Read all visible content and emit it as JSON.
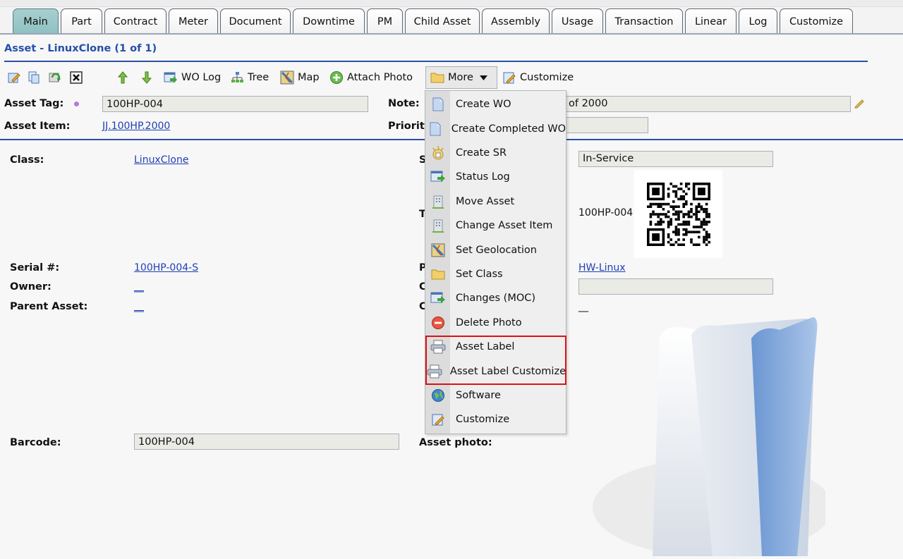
{
  "tabs": [
    {
      "label": "Main",
      "active": true
    },
    {
      "label": "Part"
    },
    {
      "label": "Contract"
    },
    {
      "label": "Meter"
    },
    {
      "label": "Document"
    },
    {
      "label": "Downtime"
    },
    {
      "label": "PM"
    },
    {
      "label": "Child Asset"
    },
    {
      "label": "Assembly"
    },
    {
      "label": "Usage"
    },
    {
      "label": "Transaction"
    },
    {
      "label": "Linear"
    },
    {
      "label": "Log"
    },
    {
      "label": "Customize"
    }
  ],
  "page": {
    "title": "Asset - LinuxClone (1 of 1)"
  },
  "toolbar": {
    "wo_log": "WO Log",
    "tree": "Tree",
    "map": "Map",
    "attach_photo": "Attach Photo",
    "more": "More",
    "customize": "Customize"
  },
  "form": {
    "asset_tag_label": "Asset Tag:",
    "asset_tag_value": "100HP-004",
    "note_label": "Note:",
    "note_value_visible": "of 2000",
    "asset_item_label": "Asset Item:",
    "asset_item_value": "JJ.100HP.2000",
    "priority_label": "Priority",
    "class_label": "Class:",
    "class_value": "LinuxClone",
    "status_value": "In-Service",
    "tag_value": "100HP-004",
    "serial_label": "Serial #:",
    "serial_value": "100HP-004-S",
    "owner_label": "Owner:",
    "owner_value": "__",
    "parent_label": "Parent Asset:",
    "parent_value": "__",
    "platform_value": "HW-Linux",
    "blank_value": "__",
    "barcode_label": "Barcode:",
    "barcode_value": "100HP-004",
    "photo_label": "Asset photo:",
    "hidden_label_s": "S",
    "hidden_label_t": "T",
    "hidden_label_p": "P",
    "hidden_label_c1": "C",
    "hidden_label_c2": "C"
  },
  "menu": {
    "items": [
      {
        "label": "Create WO",
        "icon": "document-icon"
      },
      {
        "label": "Create Completed WO",
        "icon": "document-icon"
      },
      {
        "label": "Create SR",
        "icon": "service-request-icon"
      },
      {
        "label": "Status Log",
        "icon": "log-icon"
      },
      {
        "label": "Move Asset",
        "icon": "building-icon"
      },
      {
        "label": "Change Asset Item",
        "icon": "building-icon"
      },
      {
        "label": "Set Geolocation",
        "icon": "map-icon"
      },
      {
        "label": "Set Class",
        "icon": "folder-icon"
      },
      {
        "label": "Changes (MOC)",
        "icon": "log-icon"
      },
      {
        "label": "Delete Photo",
        "icon": "delete-icon"
      },
      {
        "label": "Asset Label",
        "icon": "printer-icon"
      },
      {
        "label": "Asset Label Customize",
        "icon": "printer-icon"
      },
      {
        "label": "Software",
        "icon": "globe-icon"
      },
      {
        "label": "Customize",
        "icon": "customize-icon"
      }
    ],
    "highlight_color": "#e01010"
  },
  "colors": {
    "title_blue": "#2450a8",
    "link_blue": "#1f3fb4",
    "active_tab": "#a9cfd0"
  }
}
